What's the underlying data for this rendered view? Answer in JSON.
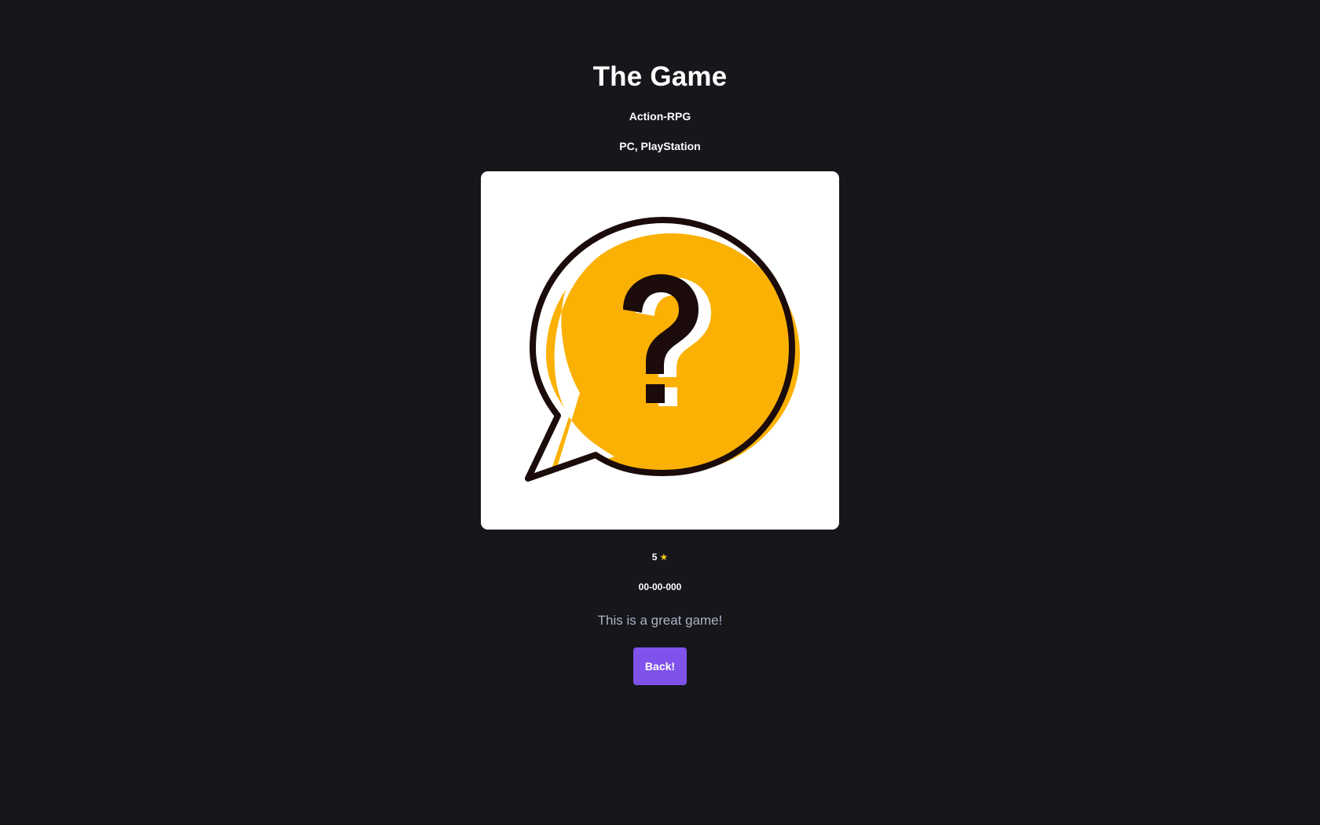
{
  "game": {
    "title": "The Game",
    "genre": "Action-RPG",
    "platforms": "PC, PlayStation",
    "cover_icon": "question-speech-bubble-icon",
    "rating": "5",
    "rating_star": "★",
    "release_date": "00-00-000",
    "description": "This is a great game!"
  },
  "actions": {
    "back_label": "Back!"
  },
  "colors": {
    "background": "#16161b",
    "button": "#8052ec",
    "star": "#f5c518",
    "bubble_fill": "#fbb104",
    "bubble_outline": "#1b0b0b",
    "description_text": "#a9b4c4"
  }
}
